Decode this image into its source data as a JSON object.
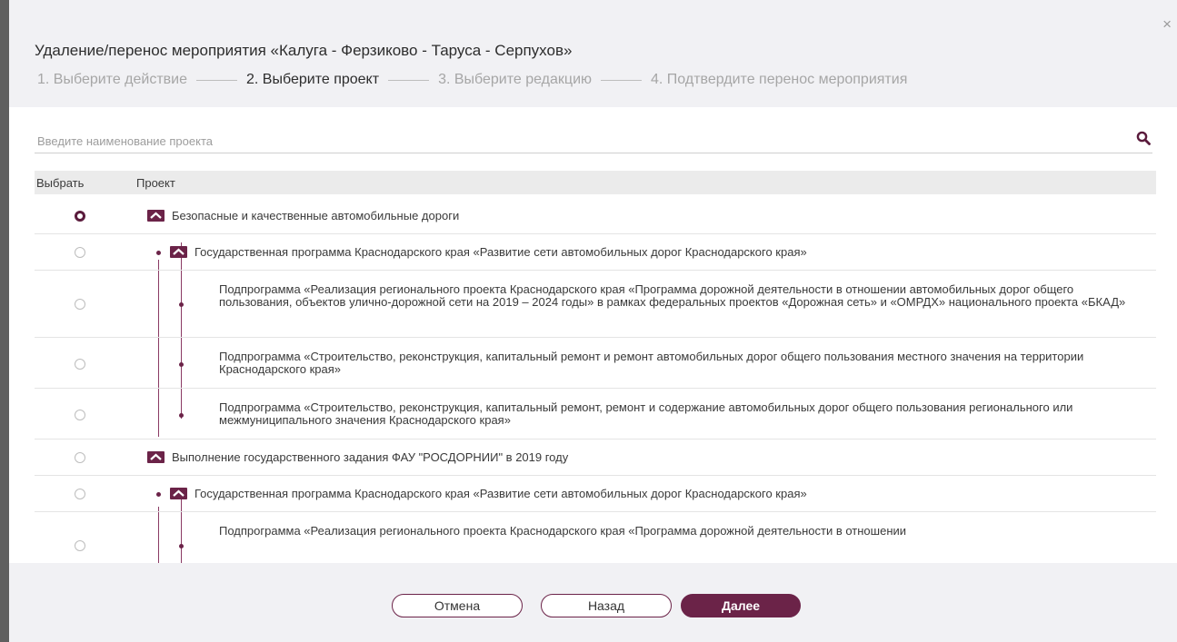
{
  "dialog": {
    "title": "Удаление/перенос мероприятия «Калуга - Ферзиково - Таруса - Серпухов»",
    "close": "×",
    "steps": [
      "1. Выберите действие",
      "2. Выберите проект",
      "3. Выберите редакцию",
      "4. Подтвердите перенос мероприятия"
    ]
  },
  "search": {
    "placeholder": "Введите наименование проекта"
  },
  "table": {
    "col_select": "Выбрать",
    "col_project": "Проект",
    "rows": [
      {
        "label": "Безопасные и качественные автомобильные дороги",
        "level": 0,
        "selected": true
      },
      {
        "label": "Государственная программа Краснодарского края «Развитие сети автомобильных дорог Краснодарского края»",
        "level": 1,
        "selected": false
      },
      {
        "label": "Подпрограмма «Реализация регионального проекта Краснодарского края «Программа дорожной деятельности в отношении автомобильных дорог общего пользования, объектов улично-дорожной сети на 2019 – 2024 годы» в рамках федеральных проектов «Дорожная сеть» и «ОМРДХ» национального проекта «БКАД»",
        "level": 2,
        "selected": false
      },
      {
        "label": "Подпрограмма «Строительство, реконструкция, капитальный ремонт и ремонт автомобильных дорог общего пользования местного значения на территории Краснодарского края»",
        "level": 2,
        "selected": false
      },
      {
        "label": "Подпрограмма «Строительство, реконструкция, капитальный ремонт, ремонт и содержание автомобильных дорог общего пользования регионального или межмуниципального значения Краснодарского края»",
        "level": 2,
        "selected": false
      },
      {
        "label": "Выполнение государственного задания ФАУ \"РОСДОРНИИ\" в 2019 году",
        "level": 0,
        "selected": false
      },
      {
        "label": "Государственная программа Краснодарского края «Развитие сети автомобильных дорог Краснодарского края»",
        "level": 1,
        "selected": false
      },
      {
        "label": "Подпрограмма «Реализация регионального проекта Краснодарского края «Программа дорожной деятельности в отношении",
        "level": 2,
        "selected": false
      }
    ]
  },
  "footer": {
    "cancel": "Отмена",
    "back": "Назад",
    "next": "Далее"
  },
  "colors": {
    "accent": "#6b2348",
    "tree_line": "#8a3a64"
  }
}
